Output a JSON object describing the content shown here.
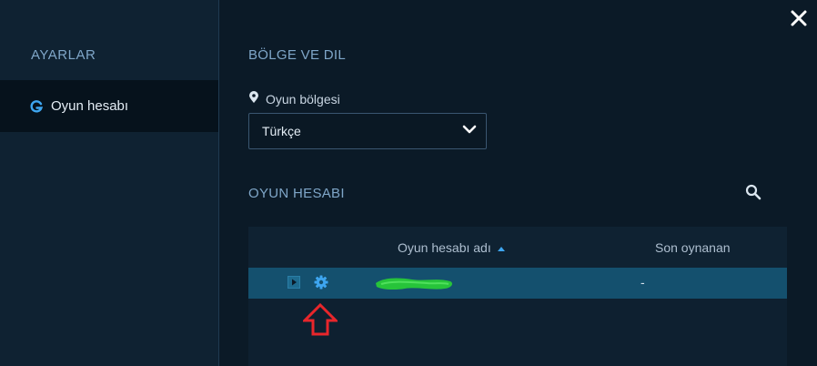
{
  "sidebar": {
    "title": "AYARLAR",
    "items": [
      {
        "label": "Oyun hesabı",
        "icon": "game-account-icon",
        "active": true
      }
    ]
  },
  "main": {
    "close_icon": "close-icon",
    "region_section": {
      "title": "BÖLGE VE DIL",
      "field_label": "Oyun bölgesi",
      "field_icon": "location-pin-icon",
      "selected_value": "Türkçe"
    },
    "account_section": {
      "title": "OYUN HESABI",
      "search_icon": "search-icon",
      "table": {
        "columns": [
          "Oyun hesabı adı",
          "Son oynanan"
        ],
        "sort_indicator": "sort-up-icon",
        "rows": [
          {
            "name": "",
            "last_played": "-",
            "row_icons": [
              "play-icon",
              "gear-icon"
            ]
          }
        ]
      }
    }
  },
  "colors": {
    "background": "#0b1a27",
    "sidebar": "#0f2232",
    "accent_blue": "#3ea6f0",
    "selected_row": "#14506e",
    "annotation_red": "#e8262b",
    "scribble_green": "#27c43a"
  }
}
